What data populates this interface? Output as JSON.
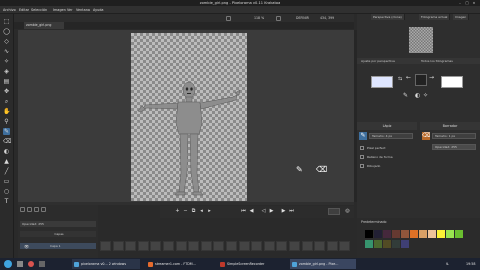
{
  "window": {
    "title": "zombie_girl.png - Pixelorama v0.11 Krakatoa"
  },
  "menu": [
    "Archivo",
    "Editar",
    "Selección",
    "Imagen",
    "Ver",
    "Ventana",
    "Ayuda"
  ],
  "tool_options": {
    "zoom": "118 %",
    "fields": [
      "DEFINIR",
      "434, 399"
    ]
  },
  "document": {
    "tab_label": "zombie_girl.png"
  },
  "right_dock": {
    "tabs": [
      "Perspectiva (clone)",
      "Fotograma actual",
      "Imagen"
    ],
    "mini_tabs": [
      "Ajuste por perspectiva",
      "Todos los fotogramas"
    ],
    "left_tool": {
      "header": "Lápiz",
      "size_field": "Tamaño: 4 px",
      "options": [
        "Pixel perfect",
        "Relleno de forma",
        "Dibujado"
      ]
    },
    "right_tool": {
      "header": "Borrador",
      "size_field": "Tamaño: 1 px",
      "opacity_field": "Opacidad: 255"
    },
    "primary_color": "#dfe6ff",
    "secondary_color": "#ffffff"
  },
  "palette": {
    "title": "Predeterminado",
    "colors": [
      "#000000",
      "#222034",
      "#45283c",
      "#663931",
      "#8f563b",
      "#df7126",
      "#d9a066",
      "#eec39a",
      "#fbf236",
      "#99e550",
      "#6abe30",
      "#37946e",
      "#4b692f",
      "#524b24",
      "#323c39",
      "#3f3f74"
    ]
  },
  "layers": {
    "title": "Capas",
    "opacity_label": "Opacidad: 255",
    "rows": [
      "Capa 1"
    ]
  },
  "taskbar": {
    "items": [
      "pixelorama v0... 2 windows",
      "streamer1.com - FTDM...",
      "SimpleScreenRecorder",
      "zombie_girl.png - Pixe..."
    ],
    "clock": "19:58"
  }
}
